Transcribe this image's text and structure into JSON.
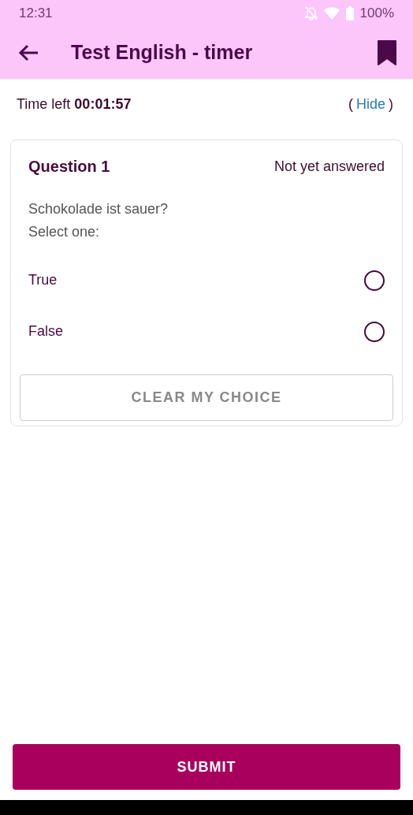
{
  "status_bar": {
    "time": "12:31",
    "battery": "100%"
  },
  "app_bar": {
    "title": "Test English - timer"
  },
  "timer": {
    "text": "Time left **00:01:57**",
    "open_paren": "(",
    "link": "Hide",
    "close_paren": ")"
  },
  "question": {
    "title": "Question 1",
    "state": "Not yet answered",
    "text": "Schokolade ist sauer?",
    "prompt": "Select one:",
    "options": [
      {
        "label": "True",
        "selected": false
      },
      {
        "label": "False",
        "selected": false
      }
    ],
    "clear_button": "CLEAR MY CHOICE"
  },
  "submit_button": "SUBMIT"
}
